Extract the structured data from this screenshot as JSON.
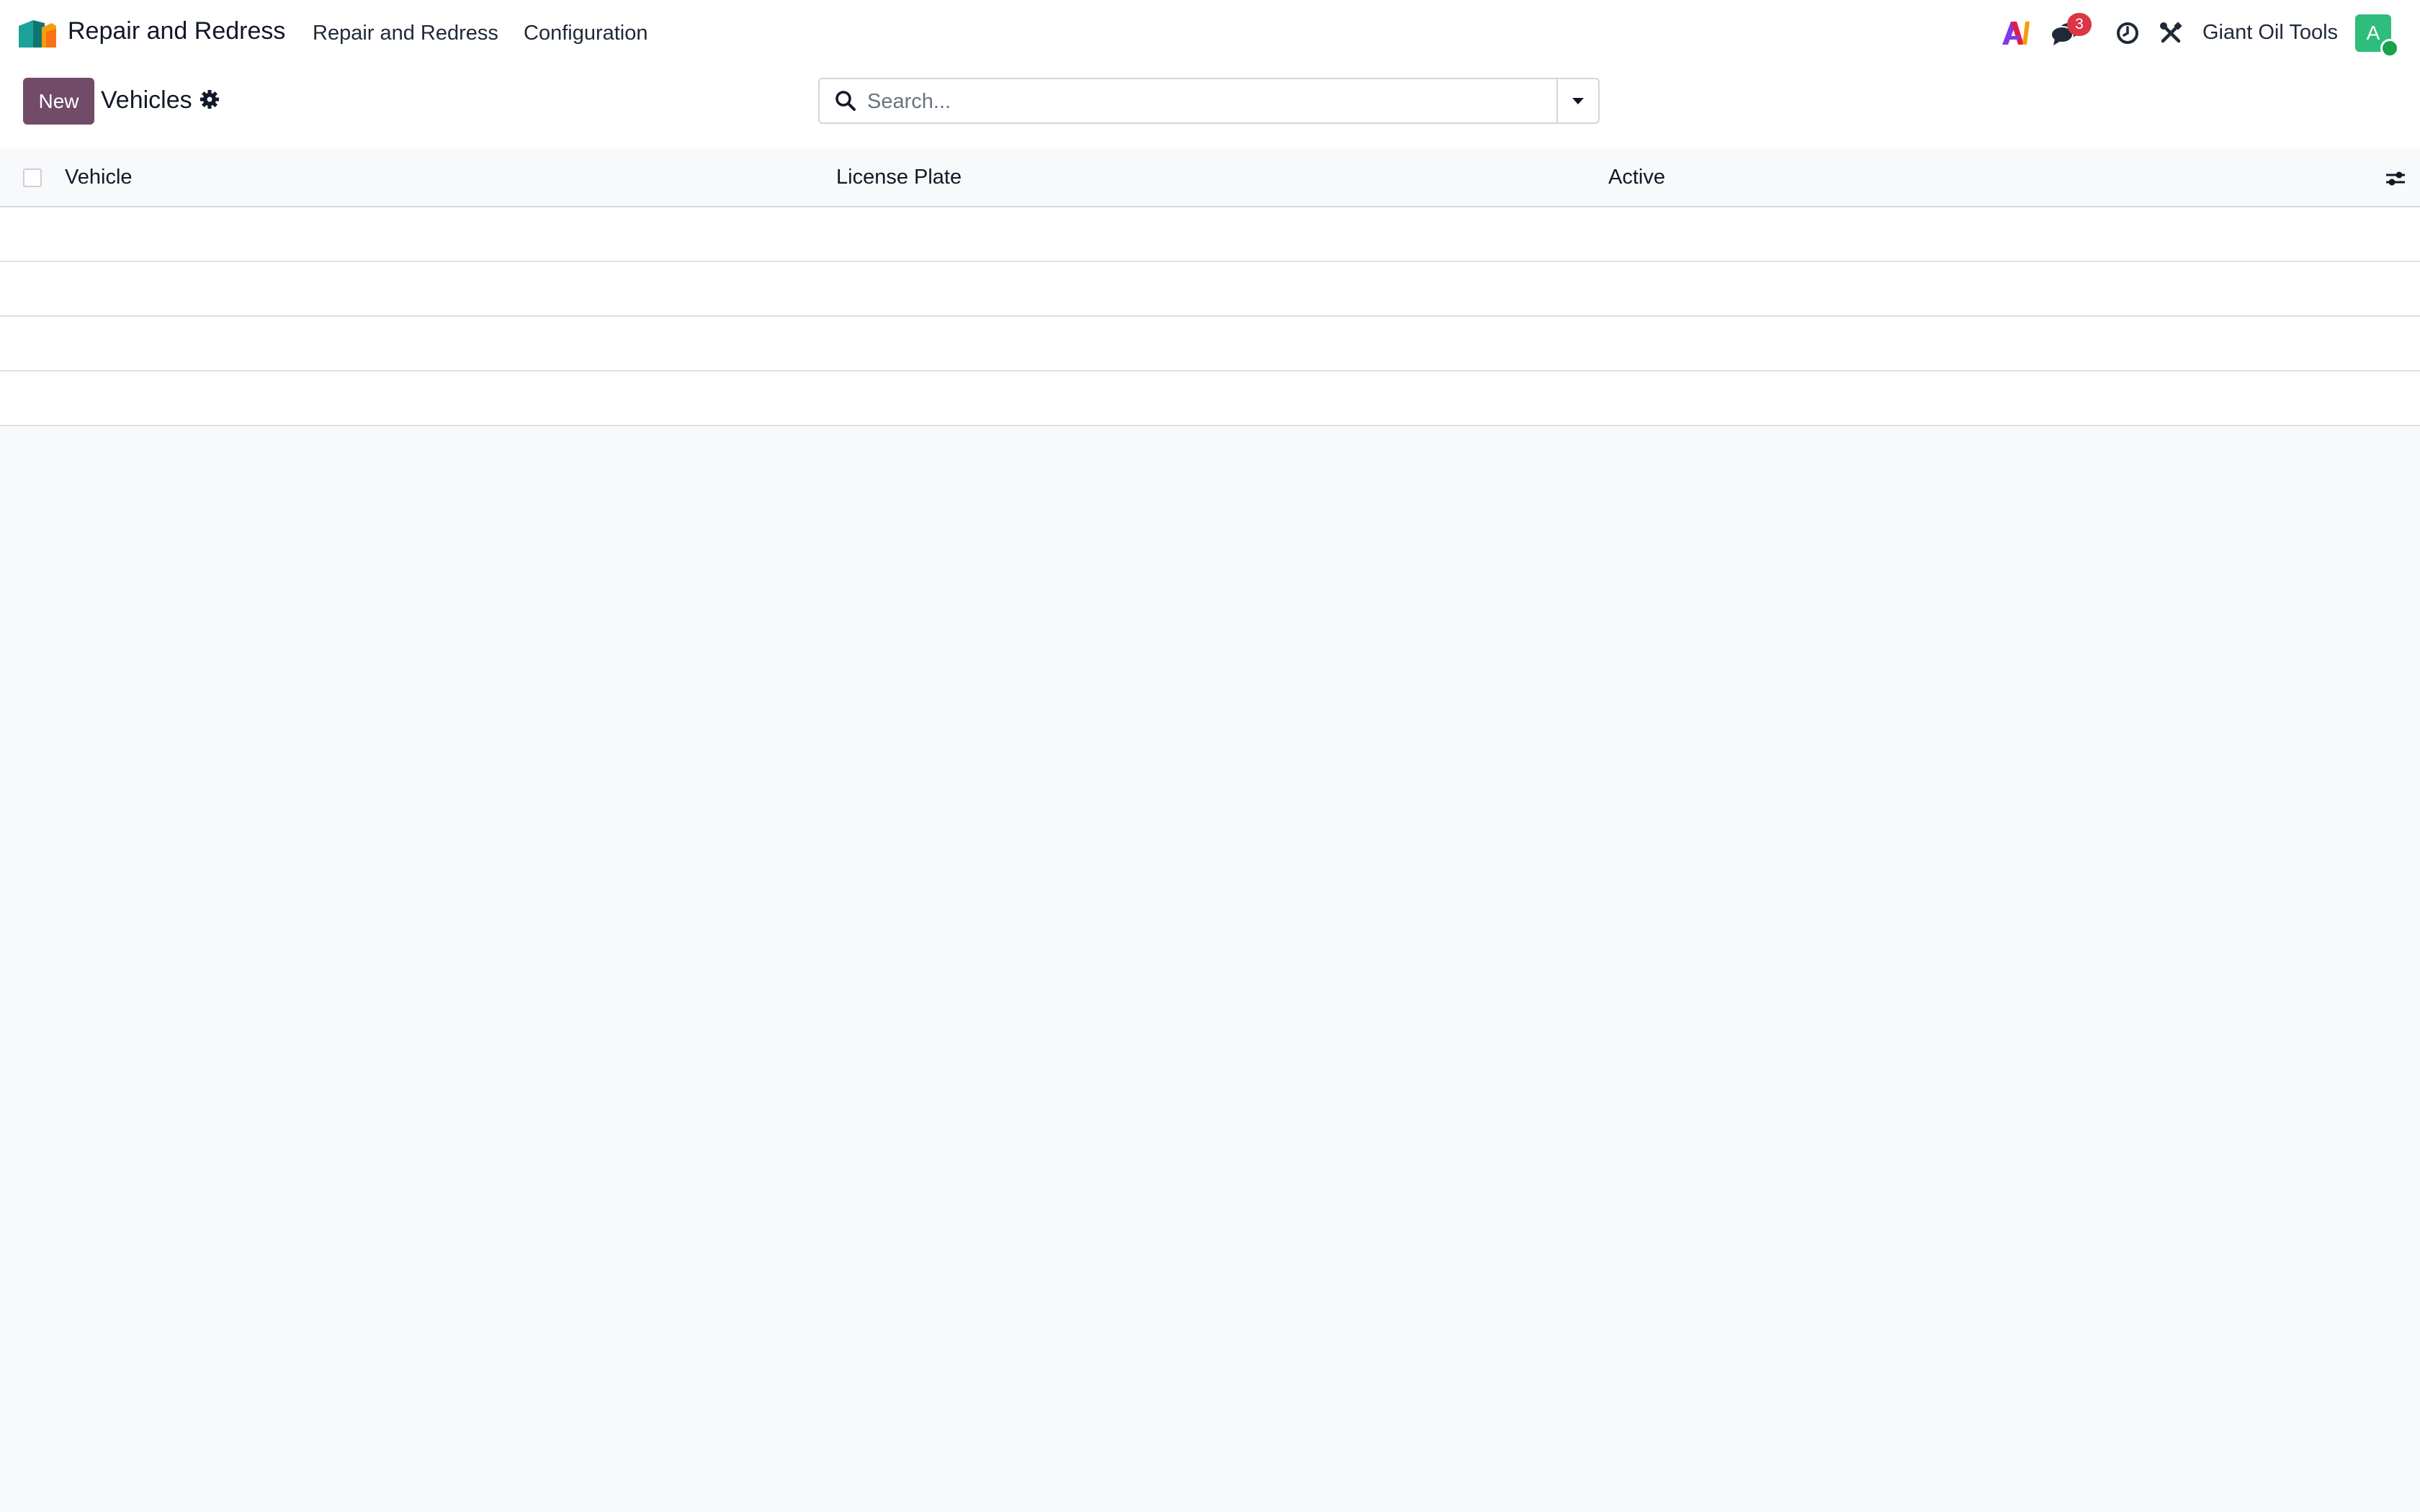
{
  "navbar": {
    "app_name": "Repair and Redress",
    "menu": [
      "Repair and Redress",
      "Configuration"
    ],
    "messages_badge": "3",
    "company": "Giant Oil Tools",
    "avatar_initial": "A",
    "icons": [
      "ai-icon",
      "chat-icon",
      "clock-icon",
      "tools-icon"
    ]
  },
  "control_panel": {
    "new_label": "New",
    "breadcrumb": "Vehicles",
    "search_placeholder": "Search..."
  },
  "table": {
    "columns": [
      "Vehicle",
      "License Plate",
      "Active"
    ],
    "rows": []
  },
  "colors": {
    "primary": "#714b67",
    "badge": "#dc3545",
    "avatar": "#2ebd7a",
    "background": "#f8f9fa"
  }
}
